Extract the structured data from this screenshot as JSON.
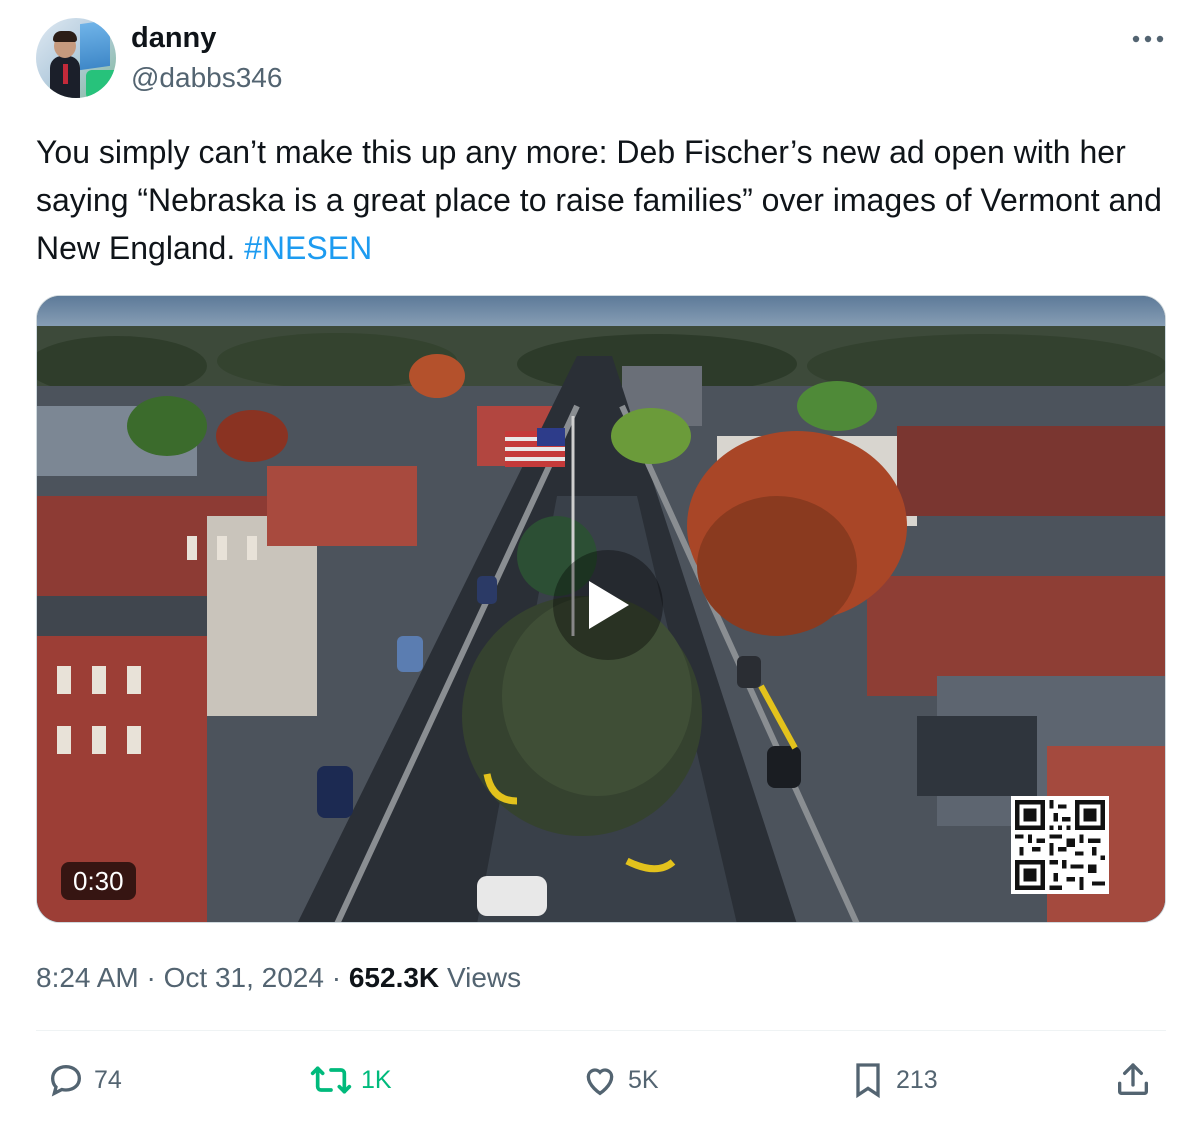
{
  "author": {
    "display_name": "danny",
    "handle": "@dabbs346"
  },
  "tweet": {
    "text": "You simply can’t make this up any more: Deb Fischer’s new ad open with her saying “Nebraska is a great place to raise families” over images of Vermont and New England. ",
    "hashtag": "#NESEN"
  },
  "video": {
    "duration": "0:30"
  },
  "meta": {
    "time": "8:24 AM",
    "separator": "·",
    "date": "Oct 31, 2024",
    "views_count": "652.3K",
    "views_label": "Views"
  },
  "actions": {
    "replies": "74",
    "retweets": "1K",
    "likes": "5K",
    "bookmarks": "213"
  },
  "colors": {
    "hashtag": "#1d9bf0",
    "retweet": "#00ba7c",
    "muted": "#536471"
  }
}
